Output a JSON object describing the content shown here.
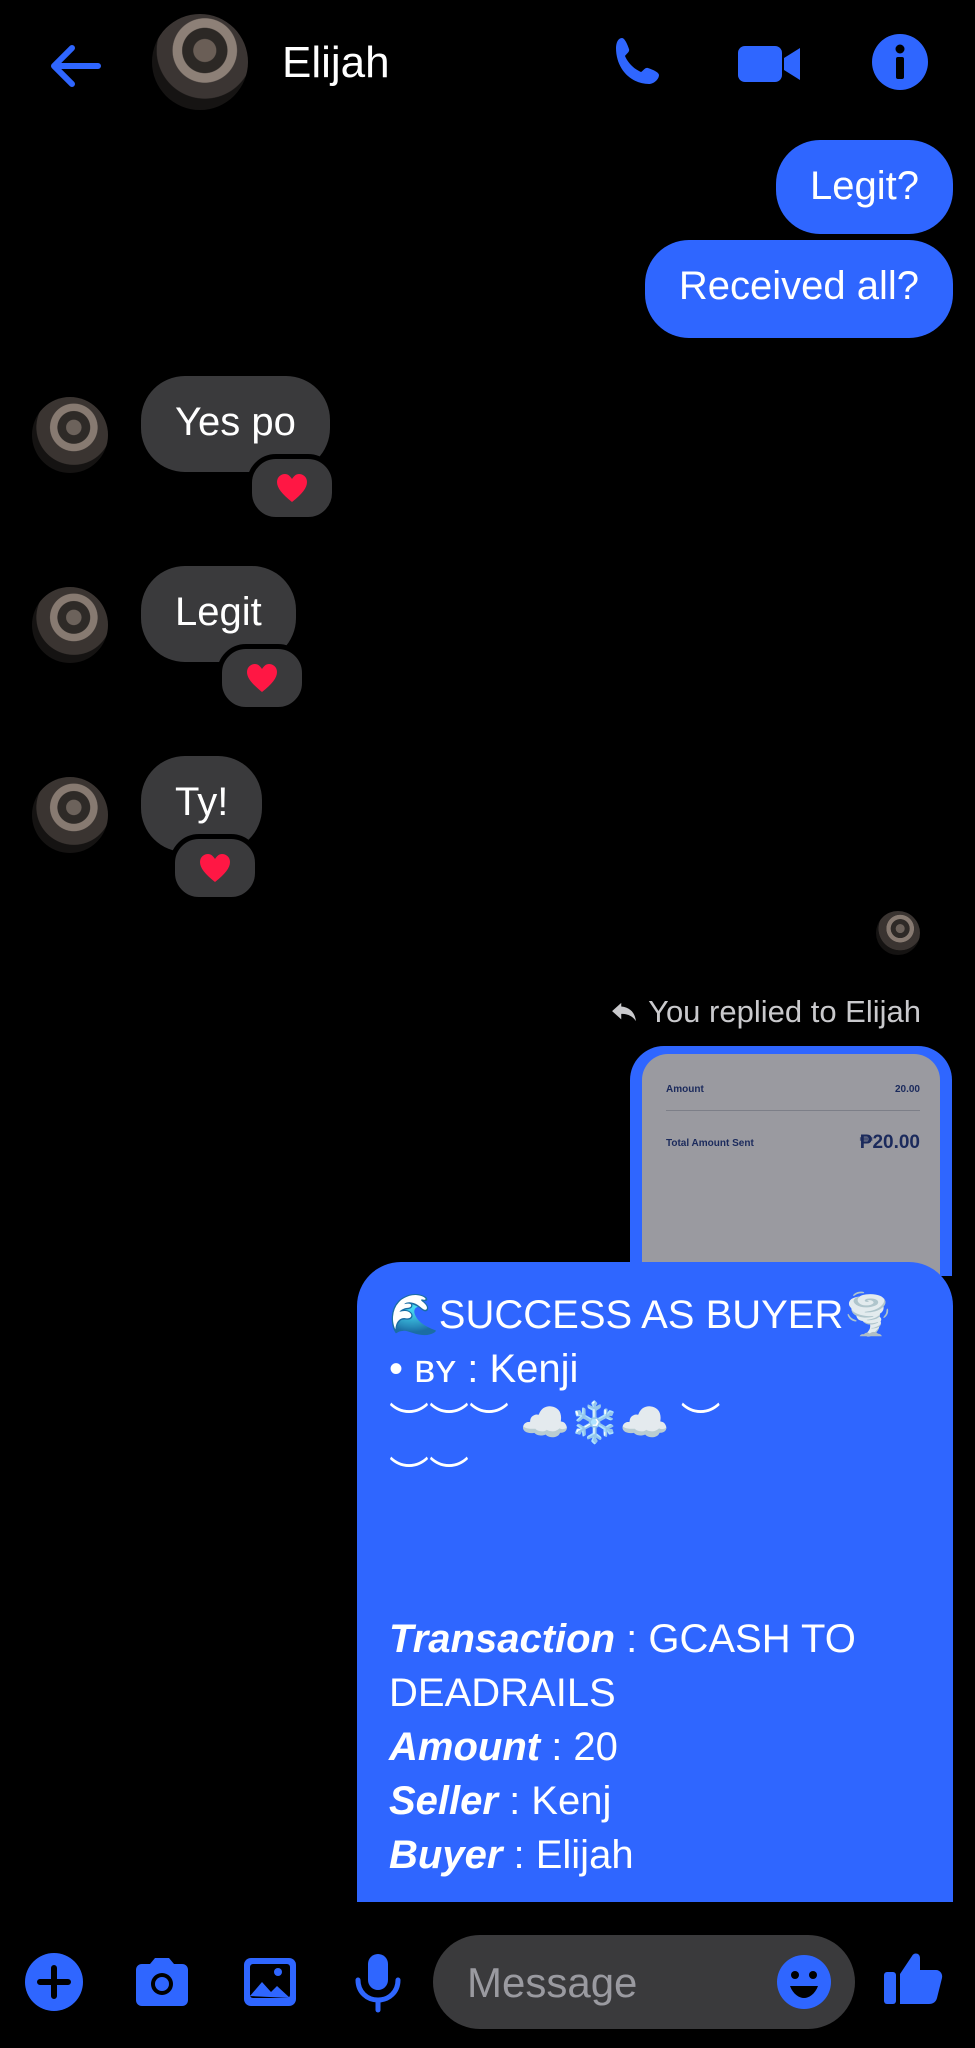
{
  "header": {
    "contact_name": "Elijah"
  },
  "messages": {
    "out1": "Legit?",
    "out2": "Received all?",
    "in1": "Yes po",
    "in2": "Legit",
    "in3": "Ty!",
    "reaction": "❤️"
  },
  "reply": {
    "notice": "You replied to Elijah",
    "preview": {
      "amount_label": "Amount",
      "amount_value": "20.00",
      "total_label": "Total Amount Sent",
      "total_value": "₱20.00"
    }
  },
  "card": {
    "line1": "🌊SUCCESS AS BUYER🌪️",
    "line2": "• ʙʏ : Kenji",
    "line3": "︶︶︶ ☁️❄️☁️ ︶",
    "line4": "︶︶",
    "transaction_label": "Transaction",
    "transaction_value": " : GCASH TO",
    "transaction_value2": "DEADRAILS",
    "amount_label": "Amount",
    "amount_value": " : 20",
    "seller_label": "Seller",
    "seller_value": " : Kenj",
    "buyer_label": "Buyer",
    "buyer_value": " : Elijah"
  },
  "composer": {
    "placeholder": "Message"
  },
  "colors": {
    "accent": "#2f66ff",
    "incoming": "#3a3a3c",
    "background": "#000000",
    "heart": "#ff1744"
  }
}
